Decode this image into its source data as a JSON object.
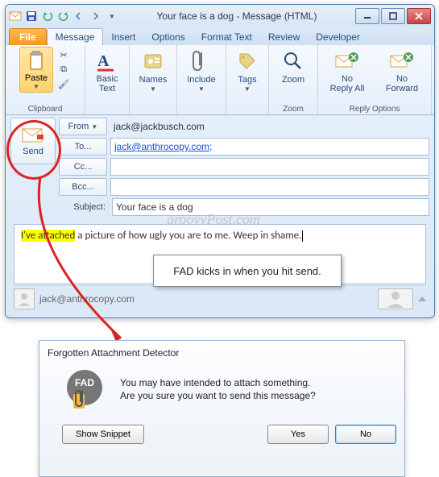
{
  "title": "Your face is a dog - Message (HTML)",
  "tabs": {
    "file": "File",
    "message": "Message",
    "insert": "Insert",
    "options": "Options",
    "format": "Format Text",
    "review": "Review",
    "developer": "Developer"
  },
  "ribbon": {
    "paste": "Paste",
    "clipboard_group": "Clipboard",
    "basic_text": "Basic\nText",
    "names": "Names",
    "include": "Include",
    "tags": "Tags",
    "zoom": "Zoom",
    "zoom_group": "Zoom",
    "no_reply_all": "No\nReply All",
    "no_forward": "No\nForward",
    "reply_options_group": "Reply Options"
  },
  "compose": {
    "send": "Send",
    "from_label": "From",
    "from_value": "jack@jackbusch.com",
    "to_label": "To...",
    "to_value": "jack@anthrocopy.com;",
    "cc_label": "Cc...",
    "bcc_label": "Bcc...",
    "subject_label": "Subject:",
    "subject_value": "Your face is a dog"
  },
  "body": {
    "highlighted": "I've attached",
    "rest": " a picture of how ugly you are to me. Weep in shame."
  },
  "from_bar": "jack@anthrocopy.com",
  "callout": "FAD kicks in when you hit send.",
  "watermark": "groovyPost.com",
  "dialog": {
    "title": "Forgotten Attachment Detector",
    "badge": "FAD",
    "line1": "You may have intended to attach something.",
    "line2": "Are you sure you want to send this message?",
    "show_snippet": "Show Snippet",
    "yes": "Yes",
    "no": "No"
  }
}
